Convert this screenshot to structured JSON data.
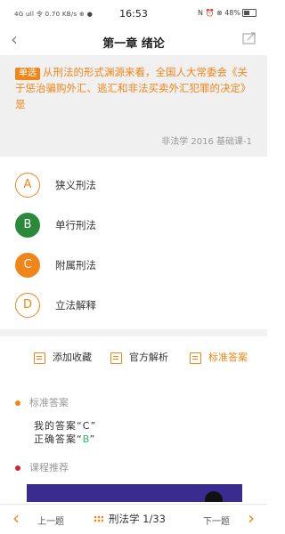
{
  "status_bar": {
    "left": "4G ull 令 0.70 KB/s ⊕ ●",
    "time": "16:53",
    "right": "N ⏰ ⊗ 48%"
  },
  "nav": {
    "back_icon": "chevron-left-icon",
    "title": "第一章 绪论",
    "share_icon": "share-icon"
  },
  "question": {
    "type_tag": "单选",
    "text": "从刑法的形式渊源来看，全国人大常委会《关于惩治骗购外汇、逃汇和非法买卖外汇犯罪的决定》是",
    "source": "非法学 2016 基础课-1"
  },
  "options": [
    {
      "letter": "A",
      "label": "狭义刑法"
    },
    {
      "letter": "B",
      "label": "单行刑法"
    },
    {
      "letter": "C",
      "label": "附属刑法"
    },
    {
      "letter": "D",
      "label": "立法解释"
    }
  ],
  "actions": {
    "favorite": "添加收藏",
    "official_analysis": "官方解析",
    "standard_answer": "标准答案"
  },
  "answer_section": {
    "title": "标准答案",
    "my_answer_prefix": "我的答案“",
    "my_answer_value": "C",
    "my_answer_suffix": "”",
    "correct_prefix": "正确答案“",
    "correct_value": "B",
    "correct_suffix": "”"
  },
  "course_section": {
    "title": "课程推荐"
  },
  "bottom": {
    "prev": "上一题",
    "progress": "刑法学 1/33",
    "next": "下一题"
  },
  "colors": {
    "accent": "#f08519",
    "correct": "#2a8a3a",
    "correct_text": "#2fb55e",
    "course_dot": "#d9232e"
  }
}
